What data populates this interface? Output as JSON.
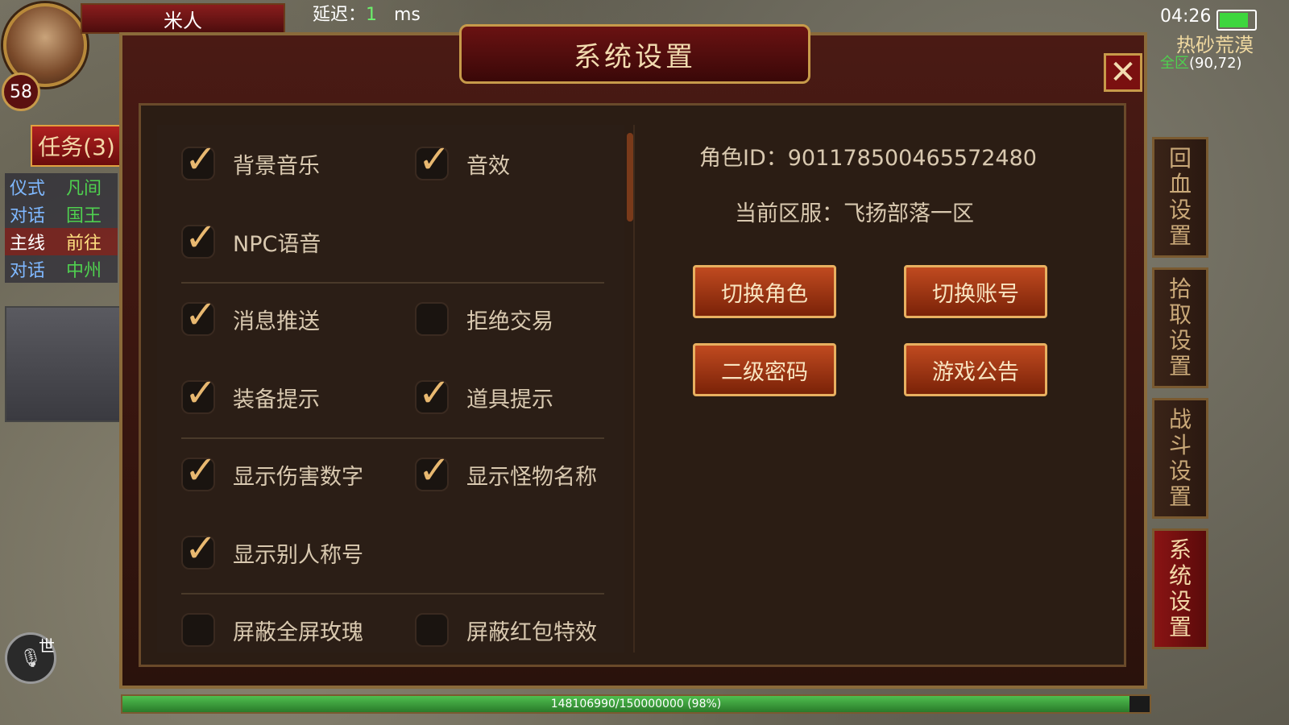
{
  "hud": {
    "player_name": "米人",
    "level": "58",
    "latency_label": "延迟：",
    "latency_value": "1",
    "latency_unit": "ms",
    "quest_button": "任务(3)",
    "quests": [
      {
        "tag": "仪式",
        "desc": "凡间"
      },
      {
        "tag": "对话",
        "desc": "国王"
      },
      {
        "tag": "主线",
        "desc": "前往"
      },
      {
        "tag": "对话",
        "desc": "中州"
      }
    ],
    "world_label": "世",
    "time": "04:26",
    "battery_level": 0.85,
    "map_name": "热砂荒漠",
    "zone_label": "全区",
    "coords": "(90,72)",
    "exp_text": "148106990/150000000 (98%)",
    "exp_fraction": 0.98
  },
  "dialog": {
    "title": "系统设置",
    "close_icon": "close-icon"
  },
  "settings": [
    {
      "label": "背景音乐",
      "checked": true
    },
    {
      "label": "音效",
      "checked": true
    },
    {
      "label": "NPC语音",
      "checked": true
    },
    {
      "label": "消息推送",
      "checked": true
    },
    {
      "label": "拒绝交易",
      "checked": false
    },
    {
      "label": "装备提示",
      "checked": true
    },
    {
      "label": "道具提示",
      "checked": true
    },
    {
      "label": "显示伤害数字",
      "checked": true
    },
    {
      "label": "显示怪物名称",
      "checked": true
    },
    {
      "label": "显示别人称号",
      "checked": true
    },
    {
      "label": "屏蔽全屏玫瑰",
      "checked": false
    },
    {
      "label": "屏蔽红包特效",
      "checked": false
    }
  ],
  "account": {
    "role_id": "角色ID：9011785004655724​80",
    "server": "当前区服：飞扬部落一区",
    "buttons": [
      "切换角色",
      "切换账号",
      "二级密码",
      "游戏公告"
    ]
  },
  "side_tabs": [
    "回血设置",
    "拾取设置",
    "战斗设置",
    "系统设置"
  ],
  "colors": {
    "accent_gold": "#c79a4a",
    "panel_bg": "#2b1e16",
    "button_red": "#c04a20"
  }
}
